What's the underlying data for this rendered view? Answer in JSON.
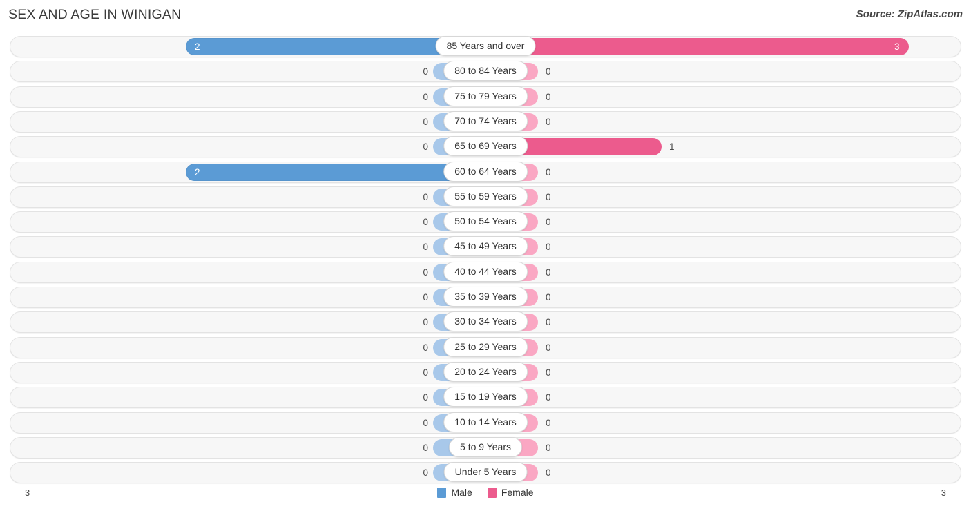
{
  "header": {
    "title": "SEX AND AGE IN WINIGAN",
    "source": "Source: ZipAtlas.com"
  },
  "legend": {
    "male_label": "Male",
    "female_label": "Female",
    "male_color": "#5b9bd5",
    "female_color": "#ec5b8d",
    "male_color_light": "#a8c8ea",
    "female_color_light": "#faa7c3"
  },
  "axis": {
    "left_tick": "3",
    "right_tick": "3",
    "max": 3
  },
  "chart_data": {
    "type": "bar",
    "title": "SEX AND AGE IN WINIGAN",
    "subtitle": "Source: ZipAtlas.com",
    "xlabel": "",
    "ylabel": "",
    "orientation": "horizontal",
    "layout": "population-pyramid",
    "grid": true,
    "legend_position": "bottom-center",
    "xlim": [
      -3,
      3
    ],
    "axis_ticks": [
      "3",
      "3"
    ],
    "categories": [
      "85 Years and over",
      "80 to 84 Years",
      "75 to 79 Years",
      "70 to 74 Years",
      "65 to 69 Years",
      "60 to 64 Years",
      "55 to 59 Years",
      "50 to 54 Years",
      "45 to 49 Years",
      "40 to 44 Years",
      "35 to 39 Years",
      "30 to 34 Years",
      "25 to 29 Years",
      "20 to 24 Years",
      "15 to 19 Years",
      "10 to 14 Years",
      "5 to 9 Years",
      "Under 5 Years"
    ],
    "series": [
      {
        "name": "Male",
        "color": "#5b9bd5",
        "values": [
          2,
          0,
          0,
          0,
          0,
          2,
          0,
          0,
          0,
          0,
          0,
          0,
          0,
          0,
          0,
          0,
          0,
          0
        ]
      },
      {
        "name": "Female",
        "color": "#ec5b8d",
        "values": [
          3,
          0,
          0,
          0,
          1,
          0,
          0,
          0,
          0,
          0,
          0,
          0,
          0,
          0,
          0,
          0,
          0,
          0
        ]
      }
    ]
  },
  "rows": [
    {
      "age": "85 Years and over",
      "male": "2",
      "female": "3"
    },
    {
      "age": "80 to 84 Years",
      "male": "0",
      "female": "0"
    },
    {
      "age": "75 to 79 Years",
      "male": "0",
      "female": "0"
    },
    {
      "age": "70 to 74 Years",
      "male": "0",
      "female": "0"
    },
    {
      "age": "65 to 69 Years",
      "male": "0",
      "female": "1"
    },
    {
      "age": "60 to 64 Years",
      "male": "2",
      "female": "0"
    },
    {
      "age": "55 to 59 Years",
      "male": "0",
      "female": "0"
    },
    {
      "age": "50 to 54 Years",
      "male": "0",
      "female": "0"
    },
    {
      "age": "45 to 49 Years",
      "male": "0",
      "female": "0"
    },
    {
      "age": "40 to 44 Years",
      "male": "0",
      "female": "0"
    },
    {
      "age": "35 to 39 Years",
      "male": "0",
      "female": "0"
    },
    {
      "age": "30 to 34 Years",
      "male": "0",
      "female": "0"
    },
    {
      "age": "25 to 29 Years",
      "male": "0",
      "female": "0"
    },
    {
      "age": "20 to 24 Years",
      "male": "0",
      "female": "0"
    },
    {
      "age": "15 to 19 Years",
      "male": "0",
      "female": "0"
    },
    {
      "age": "10 to 14 Years",
      "male": "0",
      "female": "0"
    },
    {
      "age": "5 to 9 Years",
      "male": "0",
      "female": "0"
    },
    {
      "age": "Under 5 Years",
      "male": "0",
      "female": "0"
    }
  ]
}
